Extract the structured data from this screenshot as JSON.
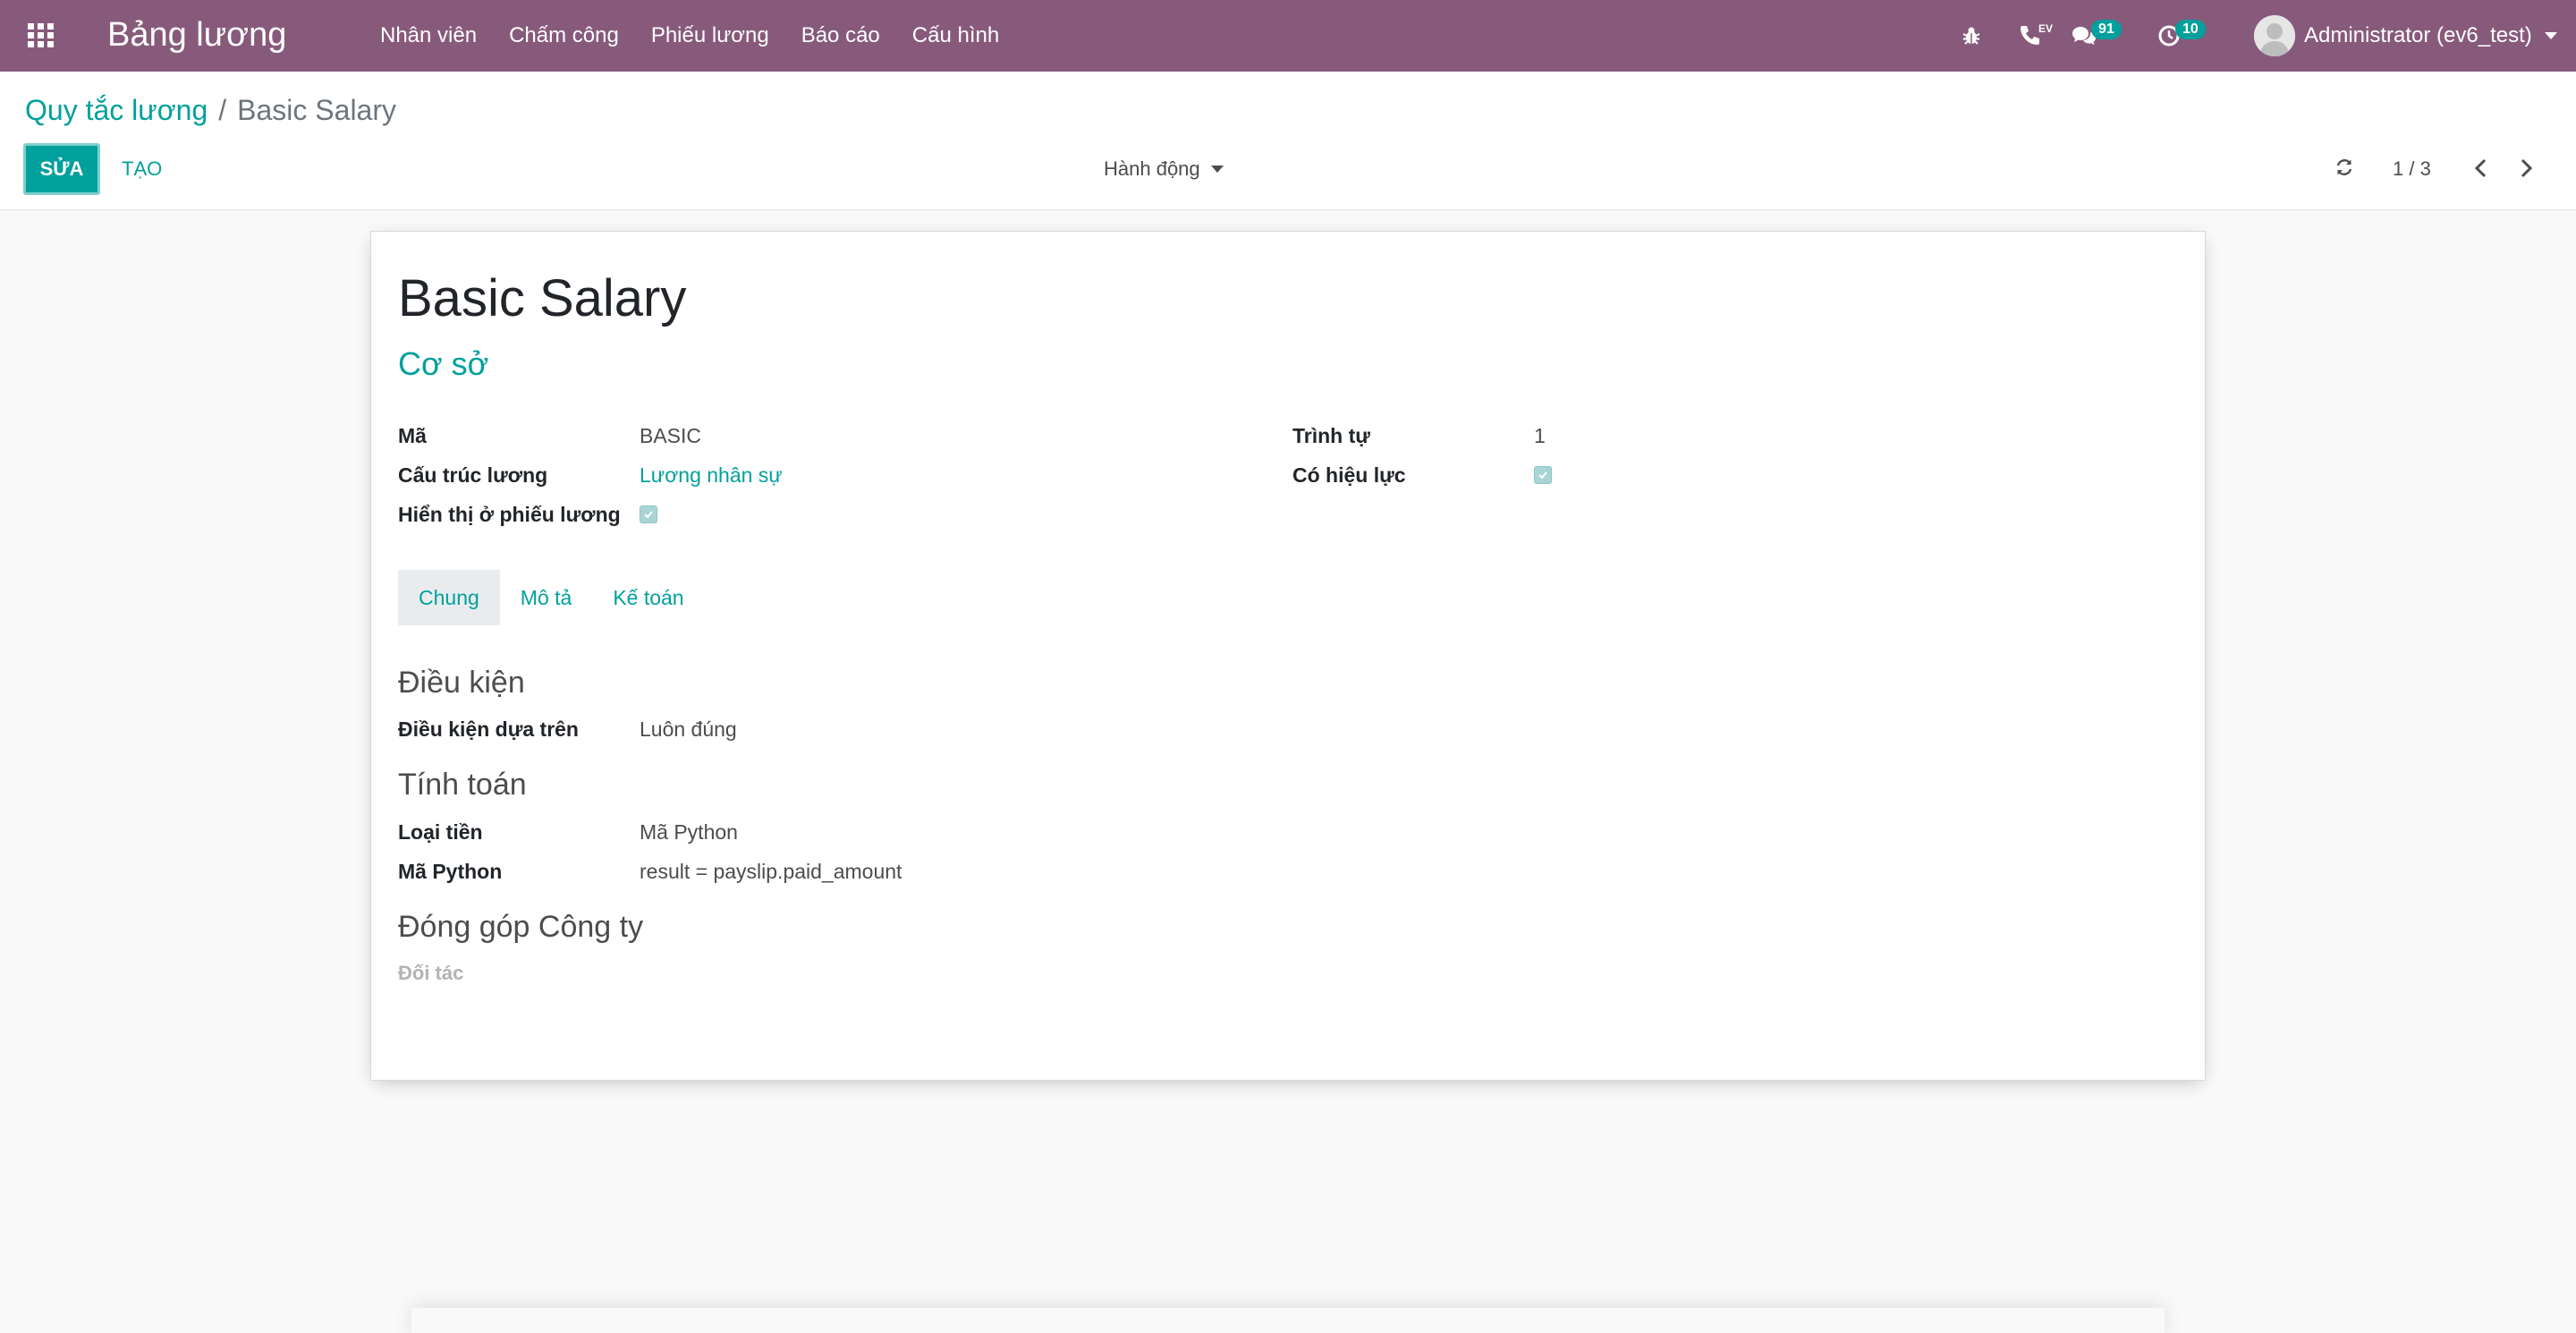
{
  "navbar": {
    "app_title": "Bảng lương",
    "menu": [
      "Nhân viên",
      "Chấm công",
      "Phiếu lương",
      "Báo cáo",
      "Cấu hình"
    ],
    "voip_label": "EV",
    "messages_count": "91",
    "activities_count": "10",
    "user_name": "Administrator (ev6_test)"
  },
  "breadcrumb": {
    "parent": "Quy tắc lương",
    "separator": "/",
    "current": "Basic Salary"
  },
  "toolbar": {
    "edit_label": "SỬA",
    "create_label": "TẠO",
    "action_label": "Hành động",
    "pager": "1 / 3"
  },
  "record": {
    "name": "Basic Salary",
    "category": "Cơ sở",
    "left_fields": [
      {
        "label": "Mã",
        "value": "BASIC"
      },
      {
        "label": "Cấu trúc lương",
        "value": "Lương nhân sự"
      },
      {
        "label": "Hiển thị ở phiếu lương",
        "checked": true
      }
    ],
    "right_fields": [
      {
        "label": "Trình tự",
        "value": "1"
      },
      {
        "label": "Có hiệu lực",
        "checked": true
      }
    ]
  },
  "tabs": [
    "Chung",
    "Mô tả",
    "Kế toán"
  ],
  "general": {
    "condition_title": "Điều kiện",
    "condition_label": "Điều kiện dựa trên",
    "condition_value": "Luôn đúng",
    "compute_title": "Tính toán",
    "amount_type_label": "Loại tiền",
    "amount_type_value": "Mã Python",
    "python_label": "Mã Python",
    "python_value": "result = payslip.paid_amount",
    "contribution_title": "Đóng góp Công ty",
    "partner_label": "Đối tác"
  },
  "colors": {
    "navbar": "#875a7b",
    "accent": "#00a09d"
  }
}
